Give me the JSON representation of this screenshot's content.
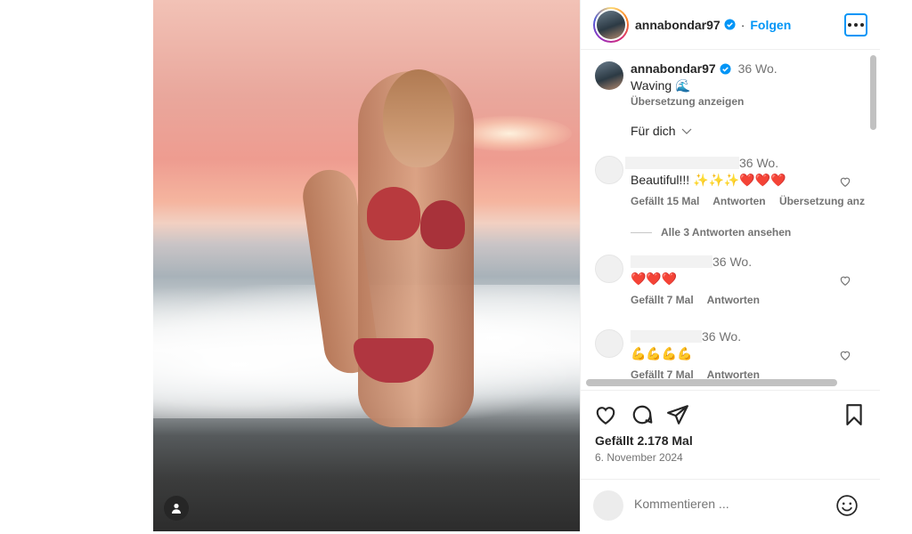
{
  "post": {
    "username": "annabondar97",
    "follow_label": "Folgen",
    "dot": "·"
  },
  "caption": {
    "username": "annabondar97",
    "time": "36 Wo.",
    "text": "Waving 🌊",
    "translate": "Übersetzung anzeigen"
  },
  "for_you": "Für dich",
  "comments": [
    {
      "time": "36 Wo.",
      "text": "Beautiful!!! ✨✨✨❤️❤️❤️",
      "likes": "Gefällt 15 Mal",
      "reply": "Antworten",
      "translate": "Übersetzung anz"
    },
    {
      "time": "36 Wo.",
      "text": "❤️❤️❤️",
      "likes": "Gefällt 7 Mal",
      "reply": "Antworten"
    },
    {
      "time": "36 Wo.",
      "text": "💪💪💪💪",
      "likes": "Gefällt 7 Mal",
      "reply": "Antworten"
    }
  ],
  "view_replies": "Alle 3 Antworten ansehen",
  "stats": {
    "likes": "Gefällt 2.178 Mal",
    "date": "6. November 2024"
  },
  "comment_input": {
    "placeholder": "Kommentieren ..."
  },
  "icons": {
    "heart": "heart-icon",
    "comment": "comment-icon",
    "share": "share-icon",
    "save": "bookmark-icon",
    "more": "more-icon",
    "emoji": "emoji-icon",
    "user_tag": "user-icon"
  },
  "colors": {
    "accent": "#0095f6",
    "verified": "#0095f6"
  }
}
